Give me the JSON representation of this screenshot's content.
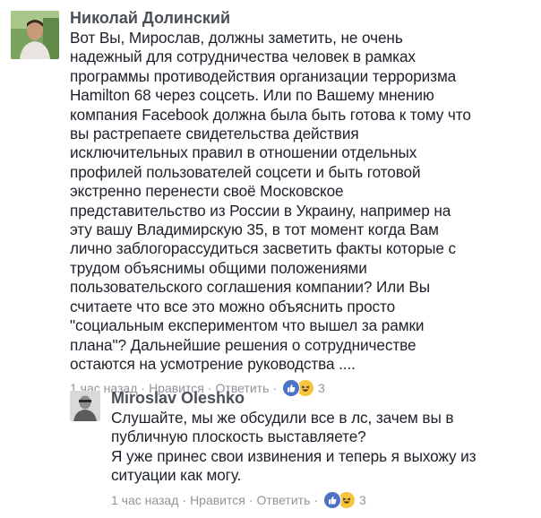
{
  "comments": [
    {
      "author": "Николай Долинский",
      "text": "Вот Вы, Мирослав, должны заметить, не очень\nнадежный для сотрудничества человек в рамках\nпрограммы противодействия организации терроризма\nHamilton 68 через соцсеть. Или по Вашему мнению\nкомпания Facebook должна была быть готова к тому что\nвы растрепаете свидетельства действия\nисключительных правил в отношении отдельных\nпрофилей пользователей соцсети и быть готовой\nэкстренно перенести своё Московское\nпредставительство из России в Украину, например на\nэту вашу Владимирскую 35, в тот момент когда Вам\nлично заблогорассудиться засветить факты которые с\nтрудом объяснимы общими положениями\nпользовательского соглашения компании? Или Вы\nсчитаете что все это можно объяснить просто\n\"социальным експериментом что вышел за рамки\nплана\"? Дальнейшие решения о сотрудничестве\nостаются на усмотрение руководства ....",
      "time": "1 час назад",
      "like_label": "Нравится",
      "reply_label": "Ответить",
      "reaction_count": "3",
      "reactions": [
        "like-icon",
        "haha-icon"
      ]
    },
    {
      "author": "Miroslav Oleshko",
      "text": "Слушайте, мы же обсудили все в лс, зачем вы в\nпубличную плоскость выставляете?\nЯ уже принес свои извинения и теперь я выхожу из\nситуации как могу.",
      "time": "1 час назад",
      "like_label": "Нравится",
      "reply_label": "Ответить",
      "reaction_count": "3",
      "reactions": [
        "like-icon",
        "haha-icon"
      ]
    }
  ],
  "separator": "·",
  "colors": {
    "author": "#4b4f56",
    "text": "#1d2129",
    "meta": "#90949c",
    "like": "#4e72c4",
    "haha": "#f7c43c"
  }
}
